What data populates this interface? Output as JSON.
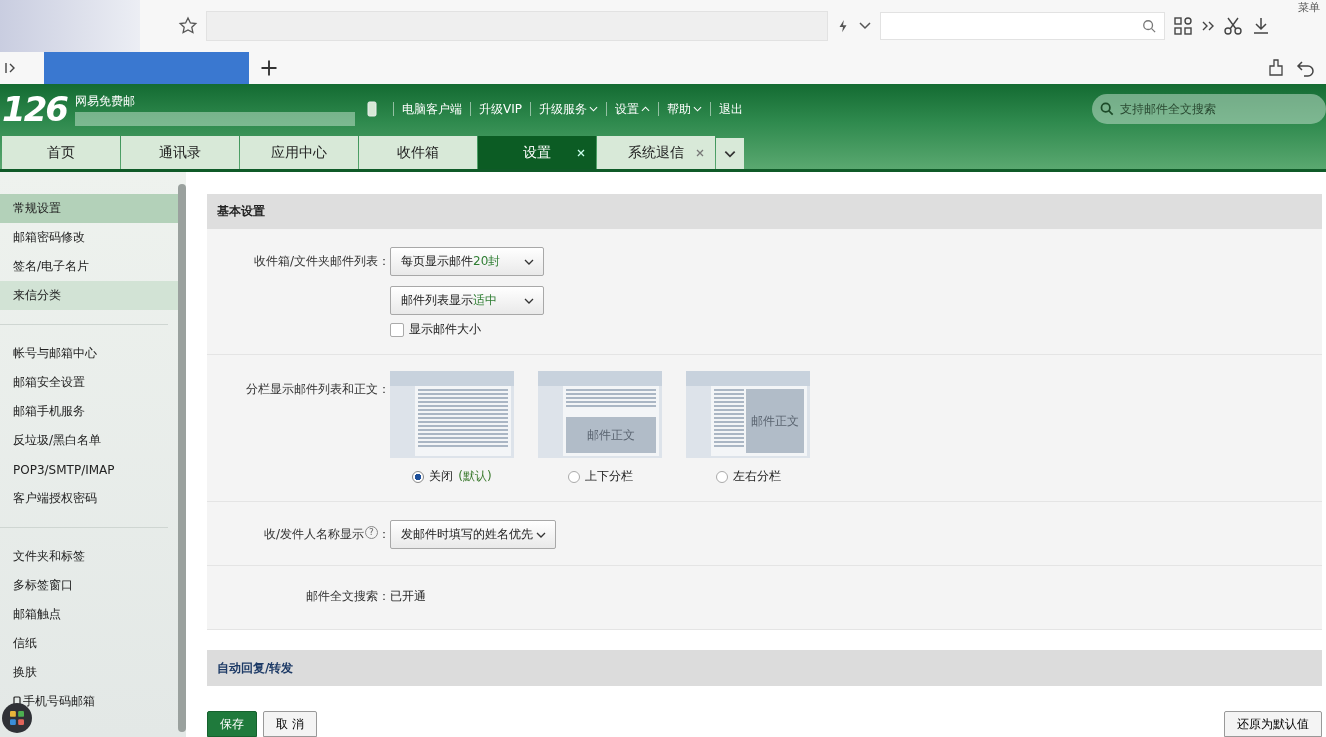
{
  "browser": {
    "menu_label": "菜单"
  },
  "header": {
    "logo": "126",
    "brand": "网易免费邮",
    "nav": [
      {
        "label": "电脑客户端",
        "menu": false
      },
      {
        "label": "升级VIP",
        "menu": false
      },
      {
        "label": "升级服务",
        "menu": true,
        "expanded": false
      },
      {
        "label": "设置",
        "menu": true,
        "expanded": true
      },
      {
        "label": "帮助",
        "menu": true,
        "expanded": false
      },
      {
        "label": "退出",
        "menu": false
      }
    ],
    "search": {
      "placeholder": "支持邮件全文搜索"
    }
  },
  "tabs": [
    {
      "label": "首页",
      "selected": false,
      "closable": false
    },
    {
      "label": "通讯录",
      "selected": false,
      "closable": false
    },
    {
      "label": "应用中心",
      "selected": false,
      "closable": false
    },
    {
      "label": "收件箱",
      "selected": false,
      "closable": false
    },
    {
      "label": "设置",
      "selected": true,
      "closable": true
    },
    {
      "label": "系统退信",
      "selected": false,
      "closable": true
    }
  ],
  "sidebar": {
    "groups": [
      [
        {
          "label": "常规设置",
          "selected": true,
          "hovered": false
        },
        {
          "label": "邮箱密码修改",
          "selected": false,
          "hovered": false
        },
        {
          "label": "签名/电子名片",
          "selected": false,
          "hovered": false
        },
        {
          "label": "来信分类",
          "selected": false,
          "hovered": true
        }
      ],
      [
        {
          "label": "帐号与邮箱中心",
          "selected": false,
          "hovered": false
        },
        {
          "label": "邮箱安全设置",
          "selected": false,
          "hovered": false
        },
        {
          "label": "邮箱手机服务",
          "selected": false,
          "hovered": false
        },
        {
          "label": "反垃圾/黑白名单",
          "selected": false,
          "hovered": false
        },
        {
          "label": "POP3/SMTP/IMAP",
          "selected": false,
          "hovered": false
        },
        {
          "label": "客户端授权密码",
          "selected": false,
          "hovered": false
        }
      ],
      [
        {
          "label": "文件夹和标签",
          "selected": false,
          "hovered": false
        },
        {
          "label": "多标签窗口",
          "selected": false,
          "hovered": false
        },
        {
          "label": "邮箱触点",
          "selected": false,
          "hovered": false
        },
        {
          "label": "信纸",
          "selected": false,
          "hovered": false
        },
        {
          "label": "换肤",
          "selected": false,
          "hovered": false
        },
        {
          "label": "手机号码邮箱",
          "selected": false,
          "hovered": false,
          "kind": "phone"
        }
      ]
    ]
  },
  "settings": {
    "title": "基本设置",
    "rows": [
      {
        "kind": "list",
        "label": "收件箱/文件夹邮件列表：",
        "dropdowns": [
          {
            "text": "每页显示邮件",
            "accent": "20封"
          },
          {
            "text": "邮件列表显示",
            "accent": "适中"
          }
        ],
        "checkbox": {
          "label": "显示邮件大小",
          "checked": false
        }
      },
      {
        "kind": "layout",
        "label": "分栏显示邮件列表和正文：",
        "options": [
          {
            "kind": "none",
            "label": "关闭",
            "note": "(默认)",
            "selected": true
          },
          {
            "kind": "top-bottom",
            "preview": "邮件正文",
            "label": "上下分栏",
            "selected": false
          },
          {
            "kind": "left-right",
            "preview": "邮件正文",
            "label": "左右分栏",
            "selected": false
          }
        ]
      },
      {
        "kind": "select",
        "label": "收/发件人名称显示",
        "help": "?",
        "colon": "：",
        "value": "发邮件时填写的姓名优先"
      },
      {
        "kind": "text",
        "label": "邮件全文搜索：",
        "value": "已开通"
      }
    ],
    "next_section": "自动回复/转发"
  },
  "buttons": [
    {
      "label": "保存",
      "kind": "primary"
    },
    {
      "label": "取 消",
      "kind": "plain"
    }
  ],
  "reset_button": "还原为默认值"
}
